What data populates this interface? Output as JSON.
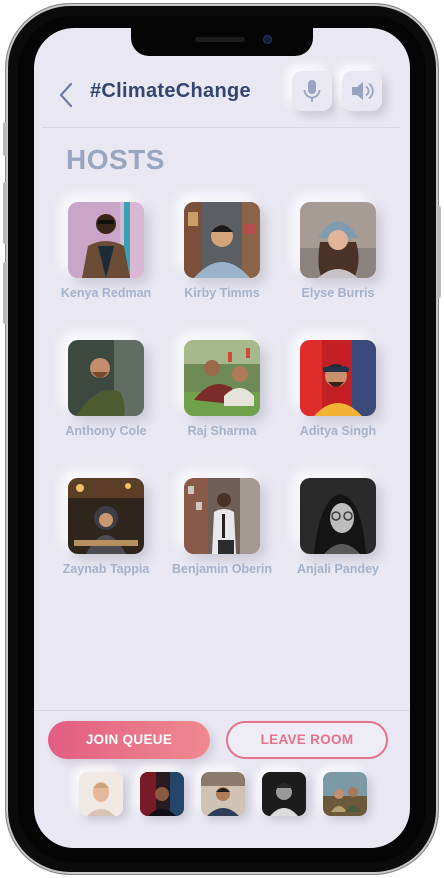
{
  "header": {
    "title": "#ClimateChange",
    "back_icon": "chevron-left-icon",
    "mic_icon": "microphone-icon",
    "speaker_icon": "speaker-volume-icon"
  },
  "hosts_section": {
    "heading": "HOSTS",
    "hosts": [
      {
        "name": "Kenya Redman"
      },
      {
        "name": "Kirby Timms"
      },
      {
        "name": "Elyse Burris"
      },
      {
        "name": "Anthony Cole"
      },
      {
        "name": "Raj Sharma"
      },
      {
        "name": "Aditya Singh"
      },
      {
        "name": "Zaynab Tappia"
      },
      {
        "name": "Benjamin Oberin"
      },
      {
        "name": "Anjali Pandey"
      }
    ]
  },
  "actions": {
    "join_label": "JOIN QUEUE",
    "leave_label": "LEAVE ROOM"
  },
  "colors": {
    "background": "#e9e8f2",
    "title": "#34466f",
    "accent_pink": "#e25d83",
    "name_text": "#a7b1c8"
  }
}
